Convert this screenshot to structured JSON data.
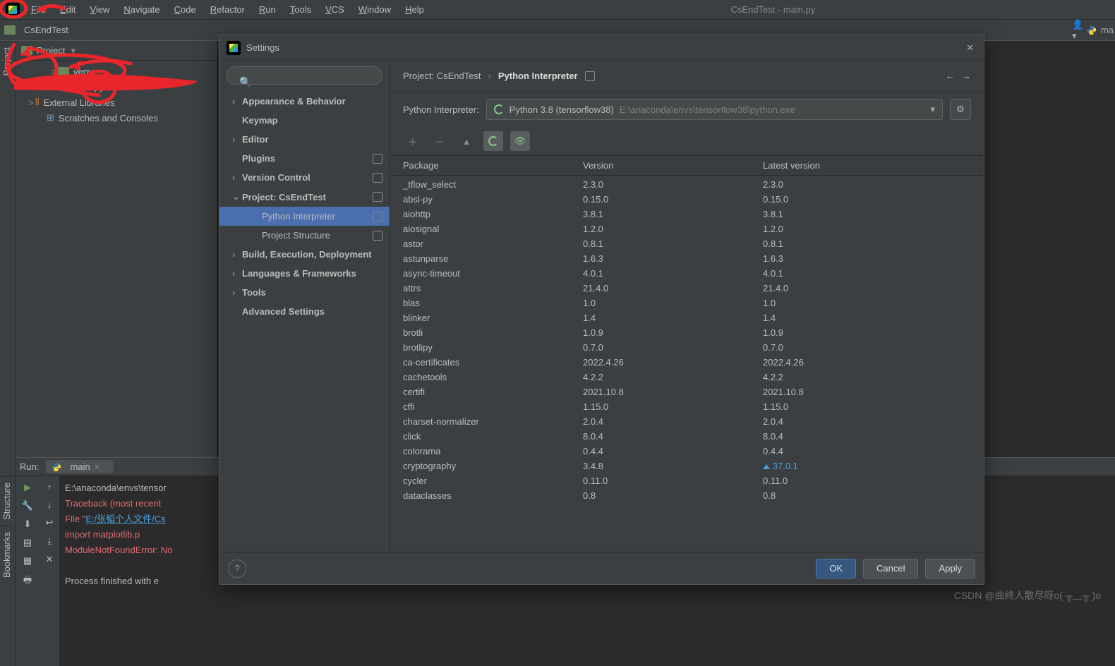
{
  "menu": {
    "items": [
      "File",
      "Edit",
      "View",
      "Navigate",
      "Code",
      "Refactor",
      "Run",
      "Tools",
      "VCS",
      "Window",
      "Help"
    ],
    "windowTitle": "CsEndTest - main.py"
  },
  "project": {
    "name": "CsEndTest",
    "toolLabel": "Project",
    "tree": [
      {
        "indent": 40,
        "chev": ">",
        "icon": "dir",
        "label": "venv"
      },
      {
        "indent": 40,
        "chev": "",
        "icon": "py",
        "label": "main.py"
      },
      {
        "indent": 8,
        "chev": ">",
        "icon": "lib",
        "label": "External Libraries"
      },
      {
        "indent": 24,
        "chev": "",
        "icon": "scr",
        "label": "Scratches and Consoles"
      }
    ]
  },
  "sidebars": {
    "left_top": "Project",
    "left_mid": "Structure",
    "left_bot": "Bookmarks"
  },
  "runwin": {
    "title": "Run:",
    "tab": "main",
    "lines": [
      {
        "t": "plain",
        "text": "E:\\anaconda\\envs\\tensor"
      },
      {
        "t": "err",
        "text": "Traceback (most recent"
      },
      {
        "t": "file",
        "pre": "  File \"",
        "link": "E:/张韬个人文件/Cs",
        "post": ""
      },
      {
        "t": "err",
        "text": "    import matplotlib.p"
      },
      {
        "t": "err",
        "text": "ModuleNotFoundError: No"
      },
      {
        "t": "blank",
        "text": ""
      },
      {
        "t": "plain",
        "text": "Process finished with e"
      }
    ]
  },
  "dialog": {
    "title": "Settings",
    "searchPlaceholder": "",
    "categories": [
      {
        "exp": ">",
        "label": "Appearance & Behavior",
        "bold": true
      },
      {
        "exp": "",
        "label": "Keymap",
        "bold": true
      },
      {
        "exp": ">",
        "label": "Editor",
        "bold": true
      },
      {
        "exp": "",
        "label": "Plugins",
        "bold": true,
        "scope": true
      },
      {
        "exp": ">",
        "label": "Version Control",
        "bold": true,
        "scope": true
      },
      {
        "exp": "v",
        "label": "Project: CsEndTest",
        "bold": true,
        "scope": true
      },
      {
        "exp": "",
        "label": "Python Interpreter",
        "bold": false,
        "sel": true,
        "scope": true,
        "indent": true
      },
      {
        "exp": "",
        "label": "Project Structure",
        "bold": false,
        "scope": true,
        "indent": true
      },
      {
        "exp": ">",
        "label": "Build, Execution, Deployment",
        "bold": true
      },
      {
        "exp": ">",
        "label": "Languages & Frameworks",
        "bold": true
      },
      {
        "exp": ">",
        "label": "Tools",
        "bold": true
      },
      {
        "exp": "",
        "label": "Advanced Settings",
        "bold": true
      }
    ],
    "breadcrumb": {
      "proj": "Project: CsEndTest",
      "sep": "›",
      "page": "Python Interpreter"
    },
    "interpLabel": "Python Interpreter:",
    "interpName": "Python 3.8 (tensorflow38)",
    "interpPath": "E:\\anaconda\\envs\\tensorflow38\\python.exe",
    "columns": {
      "pkg": "Package",
      "ver": "Version",
      "lat": "Latest version"
    },
    "packages": [
      {
        "n": "_tflow_select",
        "v": "2.3.0",
        "l": "2.3.0"
      },
      {
        "n": "absl-py",
        "v": "0.15.0",
        "l": "0.15.0"
      },
      {
        "n": "aiohttp",
        "v": "3.8.1",
        "l": "3.8.1"
      },
      {
        "n": "aiosignal",
        "v": "1.2.0",
        "l": "1.2.0"
      },
      {
        "n": "astor",
        "v": "0.8.1",
        "l": "0.8.1"
      },
      {
        "n": "astunparse",
        "v": "1.6.3",
        "l": "1.6.3"
      },
      {
        "n": "async-timeout",
        "v": "4.0.1",
        "l": "4.0.1"
      },
      {
        "n": "attrs",
        "v": "21.4.0",
        "l": "21.4.0"
      },
      {
        "n": "blas",
        "v": "1.0",
        "l": "1.0"
      },
      {
        "n": "blinker",
        "v": "1.4",
        "l": "1.4"
      },
      {
        "n": "brotli",
        "v": "1.0.9",
        "l": "1.0.9"
      },
      {
        "n": "brotlipy",
        "v": "0.7.0",
        "l": "0.7.0"
      },
      {
        "n": "ca-certificates",
        "v": "2022.4.26",
        "l": "2022.4.26"
      },
      {
        "n": "cachetools",
        "v": "4.2.2",
        "l": "4.2.2"
      },
      {
        "n": "certifi",
        "v": "2021.10.8",
        "l": "2021.10.8"
      },
      {
        "n": "cffi",
        "v": "1.15.0",
        "l": "1.15.0"
      },
      {
        "n": "charset-normalizer",
        "v": "2.0.4",
        "l": "2.0.4"
      },
      {
        "n": "click",
        "v": "8.0.4",
        "l": "8.0.4"
      },
      {
        "n": "colorama",
        "v": "0.4.4",
        "l": "0.4.4"
      },
      {
        "n": "cryptography",
        "v": "3.4.8",
        "l": "37.0.1",
        "up": true
      },
      {
        "n": "cycler",
        "v": "0.11.0",
        "l": "0.11.0"
      },
      {
        "n": "dataclasses",
        "v": "0.8",
        "l": "0.8"
      }
    ],
    "buttons": {
      "ok": "OK",
      "cancel": "Cancel",
      "apply": "Apply"
    }
  },
  "watermark": "CSDN @曲终人散尽呀o( ╥﹏╥ )o"
}
